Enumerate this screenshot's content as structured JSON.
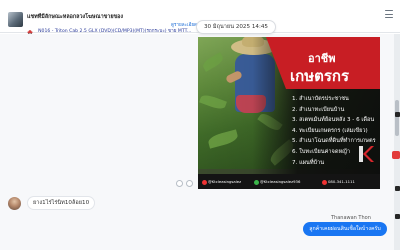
{
  "header": {
    "title": "แชทที่มีลักษณะหลอกลวงโฆษณาขายของ",
    "subtitle": "N016 - Triton Cab 2.5 GLX (DVD)(CD/MP3)(MT)(รถกระบะ) ขาย MTT...",
    "link_label": "ดูรายละเอียด",
    "date": "30 มิถุนายน 2025 14:45",
    "icons": {
      "thumbnail": "vehicle-thumbnail",
      "vehicle": "car-icon",
      "menu": "menu-icon"
    }
  },
  "promo": {
    "headline_line1": "อาชีพ",
    "headline_line2": "เกษตรกร",
    "items": [
      "1. สำเนาบัตรประชาชน",
      "2. สำเนาทะเบียนบ้าน",
      "3. สเตทเม้นท์ย้อนหลัง 3 - 6 เดือน",
      "4. ทะเบียนเกษตรกร (เล่มเขียว)",
      "5. สำเนาโฉนดที่ดินที่ทำการเกษตร",
      "6. ใบทะเบียนค่าจดหญ้า",
      "7. แผนที่บ้าน"
    ],
    "footer": [
      "@Ktcleasingsalez",
      "@Ktcleasingsalez936",
      "080-341-1111"
    ],
    "colors": {
      "accent_red": "#c81e24",
      "dark": "#141414"
    },
    "logo": "k-logo"
  },
  "messages": [
    {
      "side": "left",
      "text": "ยาง1ไร่ไร่นิท10ล้อย10",
      "avatar": "user-avatar"
    },
    {
      "side": "right",
      "sender": "Thanawan Thon",
      "text": "ลูกค้าเคยผ่อนสินเชื่อใดบ้างครับ"
    }
  ],
  "reactions": [
    "emoji-icon",
    "clock-icon"
  ],
  "colors": {
    "primary_blue": "#1976f2",
    "chat_bg": "#f7f8fa"
  }
}
